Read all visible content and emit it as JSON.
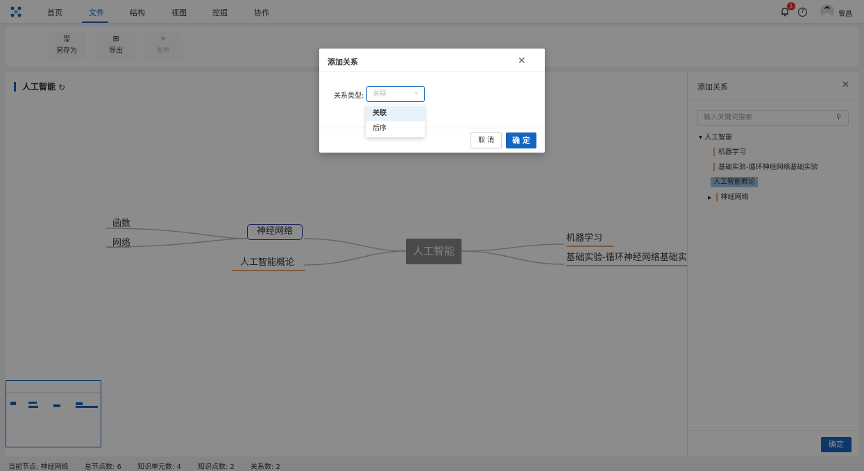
{
  "nav": {
    "items": [
      "首页",
      "文件",
      "结构",
      "视图",
      "挖掘",
      "协作"
    ],
    "notification_count": "1",
    "help_glyph": "?",
    "username": "曾昌",
    "accent": "#1565c0"
  },
  "toolbar": {
    "save_as": "另存为",
    "export": "导出",
    "publish": "发布"
  },
  "canvas": {
    "title": "人工智能",
    "nodes": {
      "func": "函数",
      "network": "网络",
      "neural": "神经网络",
      "ai_intro": "人工智能概论",
      "root": "人工智能",
      "ml": "机器学习",
      "basic_exp": "基础实验-循环神经网络基础实"
    }
  },
  "right_panel": {
    "title": "添加关系",
    "search_placeholder": "输入关键词搜索",
    "tree": {
      "root": "人工智能",
      "ml": "机器学习",
      "basic_exp": "基础实验-循环神经网络基础实验",
      "ai_intro": "人工智能概论",
      "neural": "神经网络"
    },
    "ok": "确定"
  },
  "dialog": {
    "title": "添加关系",
    "label": "关系类型:",
    "select_placeholder": "关联",
    "options": [
      "关联",
      "后序"
    ],
    "cancel": "取 消",
    "ok": "确 定"
  },
  "status": {
    "current_node": "当前节点: 神经网络",
    "total_nodes": "总节点数: 6",
    "units": "知识单元数: 4",
    "points": "知识点数: 2",
    "relations": "关系数: 2"
  }
}
